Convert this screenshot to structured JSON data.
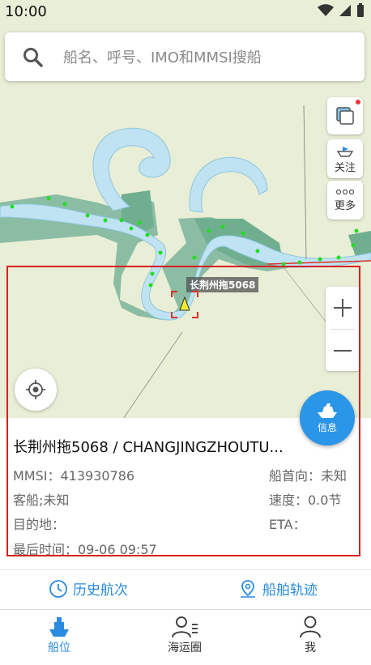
{
  "status": {
    "time": "10:00"
  },
  "search": {
    "placeholder": "船名、呼号、IMO和MMSI搜船"
  },
  "side_buttons": {
    "follow": "关注",
    "more": "更多"
  },
  "map": {
    "ship_label": "长荆州拖5068"
  },
  "info_button": {
    "label": "信息"
  },
  "ship": {
    "title": "长荆州拖5068 / CHANGJINGZHOUTU...",
    "mmsi": "MMSI：413930786",
    "heading": "船首向：未知",
    "type": "客船;未知",
    "speed": "速度：0.0节",
    "destination": "目的地：",
    "eta": "ETA：",
    "last_time": "最后时间：09-06 09:57"
  },
  "actions": {
    "history": "历史航次",
    "track": "船舶轨迹"
  },
  "tabs": [
    {
      "label": "船位",
      "icon": "ship-icon"
    },
    {
      "label": "海运圈",
      "icon": "people-icon"
    },
    {
      "label": "我",
      "icon": "person-icon"
    }
  ],
  "colors": {
    "accent": "#2a8be0",
    "highlight": "#d81f1f",
    "water": "#bfe3f2",
    "land": "#e9eed7",
    "wetland": "#6fae8f"
  }
}
